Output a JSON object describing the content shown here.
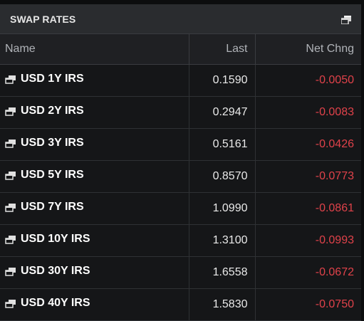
{
  "panel": {
    "title": "SWAP RATES",
    "popout_icon": "popout-window-icon"
  },
  "columns": {
    "name": "Name",
    "last": "Last",
    "net_change": "Net Chng"
  },
  "rows": [
    {
      "name": "USD 1Y IRS",
      "last": "0.1590",
      "net_change": "-0.0050"
    },
    {
      "name": "USD 2Y IRS",
      "last": "0.2947",
      "net_change": "-0.0083"
    },
    {
      "name": "USD 3Y IRS",
      "last": "0.5161",
      "net_change": "-0.0426"
    },
    {
      "name": "USD 5Y IRS",
      "last": "0.8570",
      "net_change": "-0.0773"
    },
    {
      "name": "USD 7Y IRS",
      "last": "1.0990",
      "net_change": "-0.0861"
    },
    {
      "name": "USD 10Y IRS",
      "last": "1.3100",
      "net_change": "-0.0993"
    },
    {
      "name": "USD 30Y IRS",
      "last": "1.6558",
      "net_change": "-0.0672"
    },
    {
      "name": "USD 40Y IRS",
      "last": "1.5830",
      "net_change": "-0.0750"
    }
  ],
  "colors": {
    "header_bg": "#2a2c2f",
    "negative": "#e0424a",
    "text": "#ffffff"
  }
}
